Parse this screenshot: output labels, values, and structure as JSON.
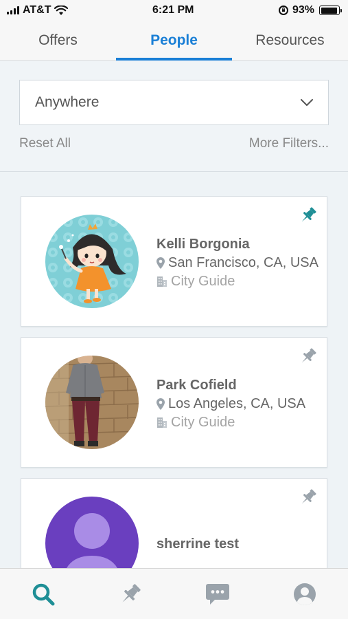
{
  "status_bar": {
    "carrier": "AT&T",
    "time": "6:21 PM",
    "battery_percent": "93%",
    "battery_level": 0.93,
    "icons": [
      "signal-icon",
      "wifi-icon",
      "orientation-lock-icon",
      "battery-icon"
    ]
  },
  "tabs": [
    {
      "label": "Offers",
      "active": false
    },
    {
      "label": "People",
      "active": true
    },
    {
      "label": "Resources",
      "active": false
    }
  ],
  "filters": {
    "location_value": "Anywhere",
    "reset_label": "Reset All",
    "more_label": "More Filters..."
  },
  "people": [
    {
      "name": "Kelli Borgonia",
      "location": "San Francisco, CA, USA",
      "role": "City Guide",
      "pinned": true,
      "avatar": "cartoon-girl-avatar"
    },
    {
      "name": "Park Cofield",
      "location": "Los Angeles, CA, USA",
      "role": "City Guide",
      "pinned": false,
      "avatar": "photo-man-avatar"
    },
    {
      "name": "sherrine test",
      "pinned": false,
      "avatar": "default-person-avatar"
    }
  ],
  "bottom_nav": [
    "search-icon",
    "pin-icon",
    "chat-icon",
    "profile-icon"
  ],
  "colors": {
    "accent_blue": "#1a7fd6",
    "teal": "#1f8f96",
    "inactive_icon": "#9aa3ab",
    "background": "#eef3f6"
  }
}
